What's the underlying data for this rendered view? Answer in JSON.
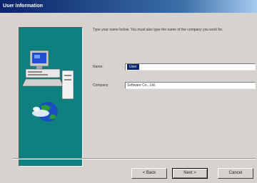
{
  "window": {
    "title": "User Information"
  },
  "instruction": "Type your name below. You must also type the name of the company you work for.",
  "fields": {
    "name": {
      "label": "Name:",
      "value": "User"
    },
    "company": {
      "label": "Company:",
      "value": "Software Co., Ltd."
    }
  },
  "buttons": {
    "back": "< Back",
    "next": "Next >",
    "cancel": "Cancel"
  },
  "colors": {
    "side_panel": "#0f8080",
    "titlebar": "#0a246a",
    "selection": "#0a246a"
  }
}
